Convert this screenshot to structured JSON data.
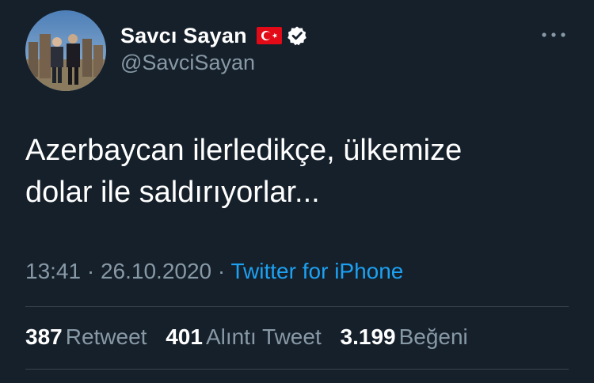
{
  "user": {
    "display_name": "Savcı Sayan",
    "handle": "@SavciSayan",
    "flag_icon": "turkey-flag-icon",
    "verified_icon": "verified-badge-icon"
  },
  "tweet": {
    "text": "Azerbaycan ilerledikçe, ülkemize\ndolar ile saldırıyorlar...",
    "time": "13:41",
    "separator": "·",
    "date": "26.10.2020",
    "source": "Twitter for iPhone"
  },
  "stats": {
    "retweets": {
      "count": "387",
      "label": "Retweet"
    },
    "quotes": {
      "count": "401",
      "label": "Alıntı Tweet"
    },
    "likes": {
      "count": "3.199",
      "label": "Beğeni"
    }
  },
  "colors": {
    "background": "#15202b",
    "primary_text": "#ffffff",
    "secondary_text": "#8899a6",
    "link": "#1da1f2",
    "divider": "#38444d"
  }
}
